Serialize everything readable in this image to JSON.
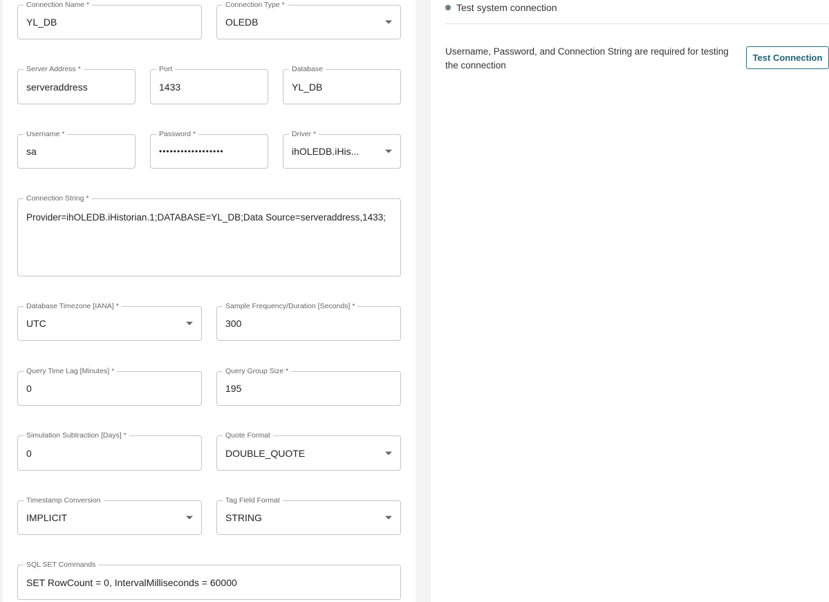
{
  "form": {
    "connection_name": {
      "label": "Connection Name *",
      "value": "YL_DB"
    },
    "connection_type": {
      "label": "Connection Type *",
      "value": "OLEDB"
    },
    "server_address": {
      "label": "Server Address *",
      "value": "serveraddress"
    },
    "port": {
      "label": "Port",
      "value": "1433"
    },
    "database": {
      "label": "Database",
      "value": "YL_DB"
    },
    "username": {
      "label": "Username *",
      "value": "sa"
    },
    "password": {
      "label": "Password *",
      "value": "••••••••••••••••••"
    },
    "driver": {
      "label": "Driver *",
      "value": "ihOLEDB.iHis..."
    },
    "connection_string": {
      "label": "Connection String *",
      "value": "Provider=ihOLEDB.iHistorian.1;DATABASE=YL_DB;Data Source=serveraddress,1433;"
    },
    "db_timezone": {
      "label": "Database Timezone [IANA] *",
      "value": "UTC"
    },
    "sample_frequency": {
      "label": "Sample Frequency/Duration [Seconds] *",
      "value": "300"
    },
    "query_time_lag": {
      "label": "Query Time Lag [Minutes] *",
      "value": "0"
    },
    "query_group_size": {
      "label": "Query Group Size *",
      "value": "195"
    },
    "simulation_subtraction": {
      "label": "Simulation Subtraction [Days] *",
      "value": "0"
    },
    "quote_format": {
      "label": "Quote Format",
      "value": "DOUBLE_QUOTE"
    },
    "timestamp_conversion": {
      "label": "Timestamp Conversion",
      "value": "IMPLICIT"
    },
    "tag_field_format": {
      "label": "Tag Field Format",
      "value": "STRING"
    },
    "sql_set_commands": {
      "label": "SQL SET Commands",
      "value": "SET RowCount = 0, IntervalMilliseconds = 60000"
    }
  },
  "test_panel": {
    "status_text": "Test system connection",
    "status_color": "#6b7f86",
    "hint": "Username, Password, and Connection String are required for testing the connection",
    "button_label": "Test Connection",
    "accent_color": "#2b6f83"
  }
}
